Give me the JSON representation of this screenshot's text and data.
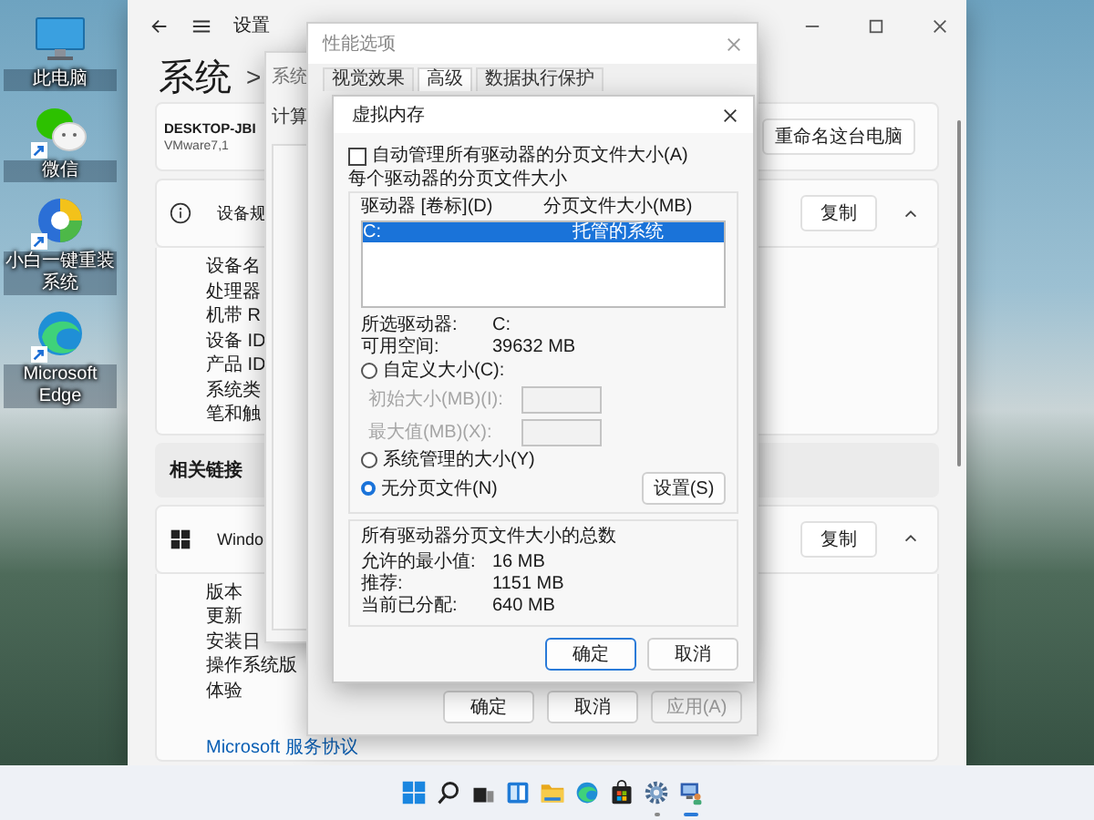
{
  "desktop": {
    "icons": [
      {
        "kind": "monitor",
        "label": "此电脑",
        "shortcut": false
      },
      {
        "kind": "wechat",
        "label": "微信",
        "shortcut": true
      },
      {
        "kind": "xiaobai",
        "label": "小白一键重装系统",
        "shortcut": true
      },
      {
        "kind": "edge",
        "label": "Microsoft Edge",
        "shortcut": true
      }
    ]
  },
  "settings_window": {
    "title": "设置",
    "heading": "系统",
    "separator": ">",
    "device": {
      "name": "DESKTOP-JBI",
      "model": "VMware7,1",
      "rename_button": "重命名这台电脑"
    },
    "sections": [
      {
        "kind": "info",
        "title": "设备规",
        "copy_button": "复制",
        "expanded": true,
        "rows": [
          "设备名",
          "处理器",
          "机带 R",
          "设备 ID",
          "产品 ID",
          "系统类",
          "笔和触"
        ]
      },
      {
        "kind": "windows",
        "title": "Windo",
        "copy_button": "复制",
        "expanded": true,
        "rows": [
          "版本",
          "更新",
          "安装日",
          "操作系统版",
          "体验"
        ],
        "link": "Microsoft 服务协议"
      }
    ],
    "related_links": {
      "label": "相关链接"
    }
  },
  "system_properties": {
    "title": "系统",
    "tab": "计算"
  },
  "performance_options": {
    "title": "性能选项",
    "tabs": [
      {
        "label": "视觉效果",
        "selected": false
      },
      {
        "label": "高级",
        "selected": true
      },
      {
        "label": "数据执行保护",
        "selected": false
      }
    ],
    "buttons": [
      {
        "label": "确定",
        "disabled": false
      },
      {
        "label": "取消",
        "disabled": false
      },
      {
        "label": "应用(A)",
        "disabled": true
      }
    ]
  },
  "virtual_memory": {
    "title": "虚拟内存",
    "auto_manage": {
      "label": "自动管理所有驱动器的分页文件大小(A)",
      "checked": false
    },
    "per_drive_group": "每个驱动器的分页文件大小",
    "columns": [
      "驱动器 [卷标](D)",
      "分页文件大小(MB)"
    ],
    "drives": [
      {
        "drive": "C:",
        "size": "托管的系统",
        "selected": true
      }
    ],
    "selected_drive": {
      "label": "所选驱动器:",
      "value": "C:"
    },
    "free_space": {
      "label": "可用空间:",
      "value": "39632 MB"
    },
    "size_options": [
      {
        "label": "自定义大小(C):",
        "selected": false
      },
      {
        "label": "系统管理的大小(Y)",
        "selected": false
      },
      {
        "label": "无分页文件(N)",
        "selected": true
      }
    ],
    "size_fields": [
      {
        "label": "初始大小(MB)(I):",
        "disabled": true
      },
      {
        "label": "最大值(MB)(X):",
        "disabled": true
      }
    ],
    "set_button": "设置(S)",
    "totals": {
      "title": "所有驱动器分页文件大小的总数",
      "rows": [
        {
          "label": "允许的最小值:",
          "value": "16 MB"
        },
        {
          "label": "推荐:",
          "value": "1151 MB"
        },
        {
          "label": "当前已分配:",
          "value": "640 MB"
        }
      ]
    },
    "buttons": [
      {
        "label": "确定",
        "default": true
      },
      {
        "label": "取消",
        "default": false
      }
    ]
  },
  "taskbar": {
    "icons": [
      {
        "kind": "start",
        "running": false,
        "active": false
      },
      {
        "kind": "search",
        "running": false,
        "active": false
      },
      {
        "kind": "taskview",
        "running": false,
        "active": false
      },
      {
        "kind": "widgets",
        "running": false,
        "active": false
      },
      {
        "kind": "folder",
        "running": false,
        "active": false
      },
      {
        "kind": "edge",
        "running": false,
        "active": false
      },
      {
        "kind": "store",
        "running": false,
        "active": false
      },
      {
        "kind": "settings",
        "running": true,
        "active": false
      },
      {
        "kind": "app",
        "running": true,
        "active": true
      }
    ]
  }
}
